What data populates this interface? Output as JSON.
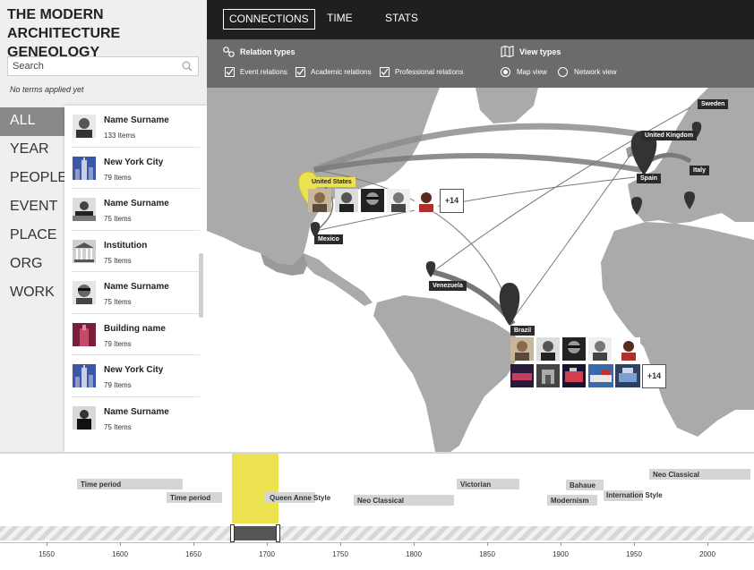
{
  "app": {
    "title_line1": "THE MODERN",
    "title_line2": "ARCHITECTURE GENEOLOGY"
  },
  "search": {
    "placeholder": "Search",
    "status": "No terms applied yet"
  },
  "facets": [
    "ALL",
    "YEAR",
    "PEOPLE",
    "EVENT",
    "PLACE",
    "ORG",
    "WORK"
  ],
  "active_facet": "ALL",
  "list": [
    {
      "name": "Name Surname",
      "count": "133 Items",
      "thumb": "person-photo"
    },
    {
      "name": "New York City",
      "count": "79 Items",
      "thumb": "city-photo"
    },
    {
      "name": "Name Surname",
      "count": "75 Items",
      "thumb": "person-photo"
    },
    {
      "name": "Institution",
      "count": "75 Items",
      "thumb": "building-photo"
    },
    {
      "name": "Name Surname",
      "count": "75 Items",
      "thumb": "person-photo"
    },
    {
      "name": "Building name",
      "count": "79 Items",
      "thumb": "building-photo"
    },
    {
      "name": "New York City",
      "count": "79 Items",
      "thumb": "city-photo"
    },
    {
      "name": "Name Surname",
      "count": "75 Items",
      "thumb": "person-photo"
    }
  ],
  "tabs": [
    "CONNECTIONS",
    "TIME",
    "STATS"
  ],
  "active_tab": "CONNECTIONS",
  "filters": {
    "relation_title": "Relation types",
    "relations": [
      "Event relations",
      "Academic relations",
      "Professional relations"
    ],
    "view_title": "View types",
    "views": [
      "Map view",
      "Network view"
    ],
    "active_view": "Map view"
  },
  "map": {
    "countries": [
      "United States",
      "Mexico",
      "Venezuela",
      "Brazil",
      "United Kingdom",
      "Sweden",
      "Spain",
      "Italy"
    ],
    "us_more": "+14",
    "brazil_more": "+14"
  },
  "timeline": {
    "periods": [
      "Time period",
      "Time period",
      "Queen Anne Style",
      "Neo Classical",
      "Victorian",
      "Bahaue",
      "Modernism",
      "Internation Style",
      "Neo Classical"
    ],
    "axis_labels": [
      "1550",
      "1600",
      "1650",
      "1700",
      "1750",
      "1800",
      "1850",
      "1900",
      "1950",
      "2000"
    ]
  },
  "colors": {
    "accent": "#ece14e",
    "dark": "#1f1f1f",
    "land": "#a9a9a9",
    "filterbar": "#6b6b6b"
  }
}
